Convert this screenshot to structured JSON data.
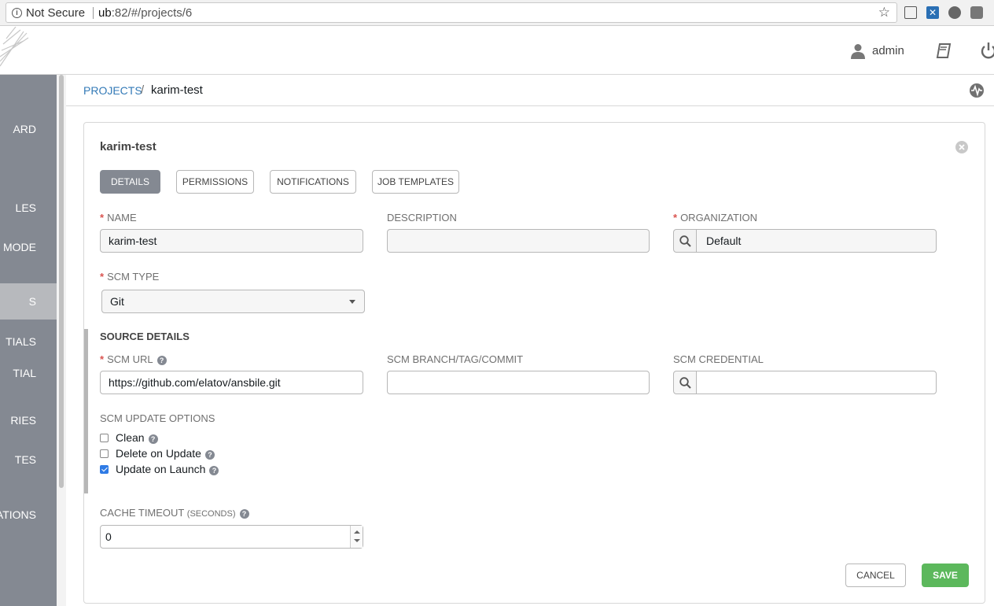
{
  "browser": {
    "security_label": "Not Secure",
    "url_host": "ub",
    "url_rest": ":82/#/projects/6"
  },
  "header": {
    "username": "admin"
  },
  "sidebar": {
    "items": [
      {
        "label": "ARD",
        "active": false
      },
      {
        "label": "LES",
        "active": false
      },
      {
        "label": "MODE",
        "active": false
      },
      {
        "label": "S",
        "active": true
      },
      {
        "label": "TIALS",
        "active": false
      },
      {
        "label": "TIAL",
        "active": false
      },
      {
        "label": "RIES",
        "active": false
      },
      {
        "label": "TES",
        "active": false
      },
      {
        "label": "ATIONS",
        "active": false
      }
    ]
  },
  "breadcrumb": {
    "parent": "PROJECTS",
    "separator": "/",
    "current": "karim-test"
  },
  "panel": {
    "title": "karim-test",
    "tabs": [
      {
        "label": "DETAILS",
        "active": true
      },
      {
        "label": "PERMISSIONS",
        "active": false
      },
      {
        "label": "NOTIFICATIONS",
        "active": false
      },
      {
        "label": "JOB TEMPLATES",
        "active": false
      }
    ]
  },
  "form": {
    "name_label": "NAME",
    "name_value": "karim-test",
    "description_label": "DESCRIPTION",
    "description_value": "",
    "organization_label": "ORGANIZATION",
    "organization_value": "Default",
    "scm_type_label": "SCM TYPE",
    "scm_type_value": "Git",
    "source_details_title": "SOURCE DETAILS",
    "scm_url_label": "SCM URL",
    "scm_url_value": "https://github.com/elatov/ansbile.git",
    "scm_branch_label": "SCM BRANCH/TAG/COMMIT",
    "scm_branch_value": "",
    "scm_credential_label": "SCM CREDENTIAL",
    "scm_credential_value": "",
    "scm_update_options_label": "SCM UPDATE OPTIONS",
    "options": [
      {
        "label": "Clean",
        "checked": false
      },
      {
        "label": "Delete on Update",
        "checked": false
      },
      {
        "label": "Update on Launch",
        "checked": true
      }
    ],
    "cache_timeout_label": "CACHE TIMEOUT",
    "cache_timeout_unit": "(SECONDS)",
    "cache_timeout_value": "0",
    "help_glyph": "?",
    "required_glyph": "*"
  },
  "actions": {
    "cancel_label": "CANCEL",
    "save_label": "SAVE"
  },
  "colors": {
    "sidebar_bg": "#848992",
    "sidebar_active": "#b7b9bd",
    "link": "#337ab7",
    "save_green": "#5cb85c",
    "required_red": "#d9534f",
    "checkbox_blue": "#2f7be5"
  }
}
